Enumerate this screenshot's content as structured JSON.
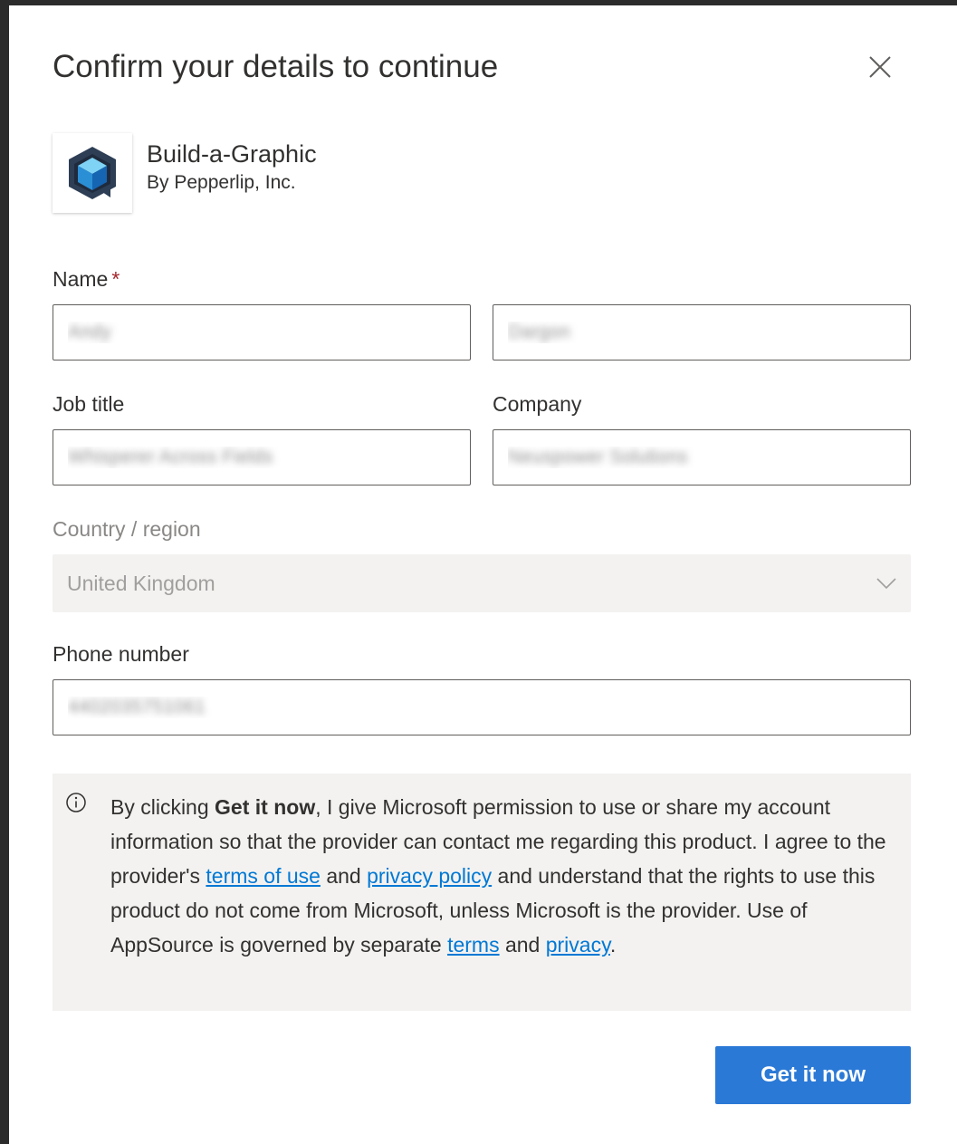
{
  "dialog": {
    "title": "Confirm your details to continue"
  },
  "app": {
    "name": "Build-a-Graphic",
    "publisher": "By Pepperlip, Inc."
  },
  "form": {
    "name_label": "Name",
    "required_marker": "*",
    "first_name_value": "Andy",
    "last_name_value": "Dargon",
    "job_title_label": "Job title",
    "job_title_value": "Whisperer Across Fields",
    "company_label": "Company",
    "company_value": "Neuspower Solutions",
    "country_label": "Country / region",
    "country_value": "United Kingdom",
    "phone_label": "Phone number",
    "phone_value": "4402035751061"
  },
  "notice": {
    "part1": "By clicking ",
    "bold": "Get it now",
    "part2": ", I give Microsoft permission to use or share my account information so that the provider can contact me regarding this product. I agree to the provider's ",
    "link_terms_of_use": "terms of use",
    "part3": " and ",
    "link_privacy_policy": "privacy policy",
    "part4": " and understand that the rights to use this product do not come from Microsoft, unless Microsoft is the provider. Use of AppSource is governed by separate ",
    "link_terms": "terms",
    "part5": " and ",
    "link_privacy": "privacy",
    "part6": "."
  },
  "actions": {
    "primary_label": "Get it now"
  },
  "icons": {
    "close": "close-icon",
    "info": "info-icon",
    "dropdown": "chevron-down-icon",
    "app_logo": "app-logo-icon"
  },
  "colors": {
    "primary": "#2b79d6",
    "link": "#0078d4",
    "required": "#a4262c",
    "panel_background": "#f3f2f1"
  }
}
